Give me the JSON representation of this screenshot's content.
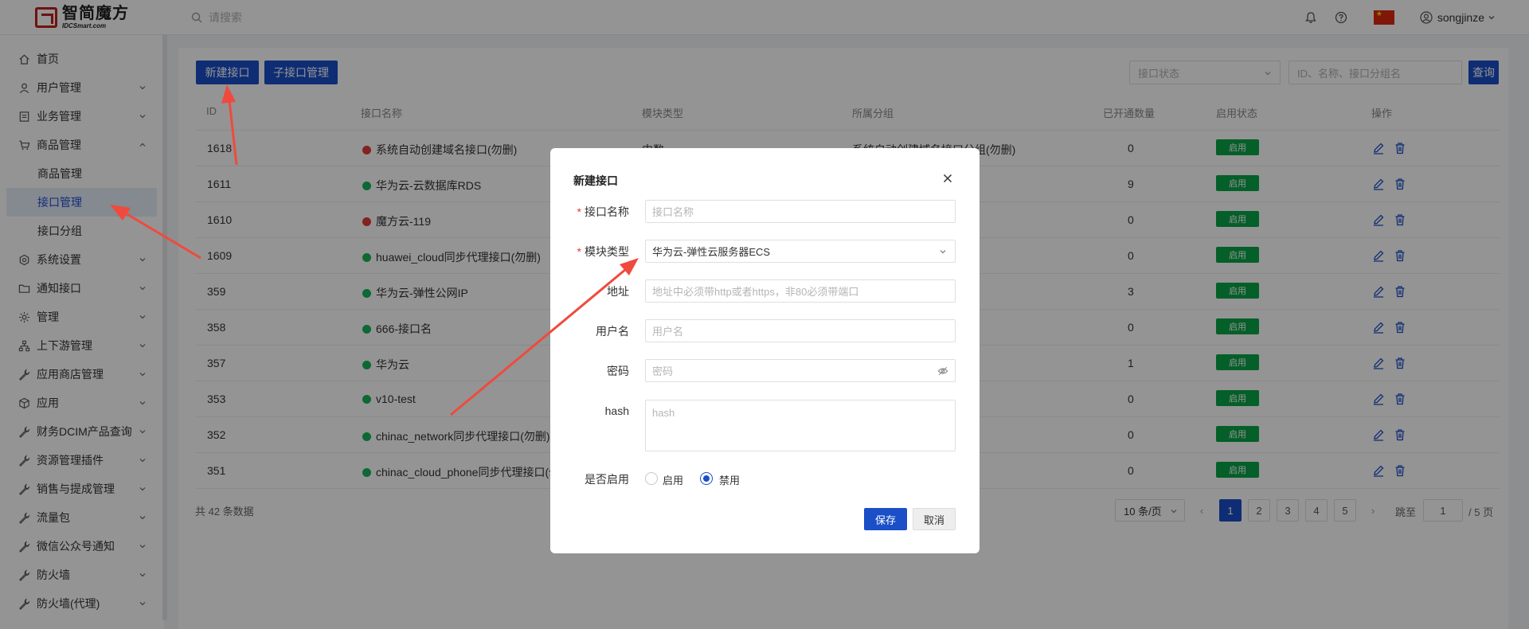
{
  "app": {
    "logo_cn": "智简魔方",
    "logo_en": "IDCSmart.com",
    "search_placeholder": "请搜索",
    "username": "songjinze",
    "colors": {
      "primary": "#1a4fc8",
      "success": "#07a447",
      "danger": "#e23b3b",
      "annotation_arrow": "#f04a3e"
    }
  },
  "sidebar": {
    "items": [
      {
        "label": "首页",
        "icon": "home-icon",
        "expandable": false
      },
      {
        "label": "用户管理",
        "icon": "user-icon",
        "expandable": true
      },
      {
        "label": "业务管理",
        "icon": "list-icon",
        "expandable": true
      },
      {
        "label": "商品管理",
        "icon": "cart-icon",
        "expandable": true,
        "expanded": true
      },
      {
        "label": "商品管理",
        "icon": "",
        "sub": true
      },
      {
        "label": "接口管理",
        "icon": "",
        "sub": true,
        "active": true
      },
      {
        "label": "接口分组",
        "icon": "",
        "sub": true
      },
      {
        "label": "系统设置",
        "icon": "gear-icon",
        "expandable": true
      },
      {
        "label": "通知接口",
        "icon": "folder-icon",
        "expandable": true
      },
      {
        "label": "管理",
        "icon": "sun-icon",
        "expandable": true
      },
      {
        "label": "上下游管理",
        "icon": "hierarchy-icon",
        "expandable": true
      },
      {
        "label": "应用商店管理",
        "icon": "wrench-icon",
        "expandable": true
      },
      {
        "label": "应用",
        "icon": "cube-icon",
        "expandable": true
      },
      {
        "label": "财务DCIM产品查询",
        "icon": "wrench-icon",
        "expandable": true
      },
      {
        "label": "资源管理插件",
        "icon": "wrench-icon",
        "expandable": true
      },
      {
        "label": "销售与提成管理",
        "icon": "wrench-icon",
        "expandable": true
      },
      {
        "label": "流量包",
        "icon": "wrench-icon",
        "expandable": true
      },
      {
        "label": "微信公众号通知",
        "icon": "wrench-icon",
        "expandable": true
      },
      {
        "label": "防火墙",
        "icon": "wrench-icon",
        "expandable": true
      },
      {
        "label": "防火墙(代理)",
        "icon": "wrench-icon",
        "expandable": true
      }
    ]
  },
  "toolbar": {
    "new_interface": "新建接口",
    "sub_interface": "子接口管理",
    "status_placeholder": "接口状态",
    "keyword_placeholder": "ID、名称、接口分组名",
    "query": "查询"
  },
  "table": {
    "headers": [
      "ID",
      "接口名称",
      "模块类型",
      "所属分组",
      "已开通数量",
      "启用状态",
      "操作"
    ],
    "rows": [
      {
        "id": "1618",
        "name": "系统自动创建域名接口(勿删)",
        "status_ok": false,
        "module": "中数",
        "group": "系统自动创建域名接口分组(勿删)",
        "count": "0",
        "state": "启用"
      },
      {
        "id": "1611",
        "name": "华为云-云数据库RDS",
        "status_ok": true,
        "module": "",
        "group": "",
        "count": "9",
        "state": "启用"
      },
      {
        "id": "1610",
        "name": "魔方云-119",
        "status_ok": false,
        "module": "",
        "group": "",
        "count": "0",
        "state": "启用"
      },
      {
        "id": "1609",
        "name": "huawei_cloud同步代理接口(勿删)",
        "status_ok": true,
        "module": "",
        "group": "",
        "count": "0",
        "state": "启用"
      },
      {
        "id": "359",
        "name": "华为云-弹性公网IP",
        "status_ok": true,
        "module": "",
        "group": "",
        "count": "3",
        "state": "启用"
      },
      {
        "id": "358",
        "name": "666-接口名",
        "status_ok": true,
        "module": "",
        "group": "",
        "count": "0",
        "state": "启用"
      },
      {
        "id": "357",
        "name": "华为云",
        "status_ok": true,
        "module": "",
        "group": "",
        "count": "1",
        "state": "启用"
      },
      {
        "id": "353",
        "name": "v10-test",
        "status_ok": true,
        "module": "",
        "group": "",
        "count": "0",
        "state": "启用"
      },
      {
        "id": "352",
        "name": "chinac_network同步代理接口(勿删)",
        "status_ok": true,
        "module": "",
        "group": "",
        "count": "0",
        "state": "启用"
      },
      {
        "id": "351",
        "name": "chinac_cloud_phone同步代理接口(勿删",
        "status_ok": true,
        "module": "",
        "group": "",
        "count": "0",
        "state": "启用"
      }
    ],
    "total": "共 42 条数据"
  },
  "pagination": {
    "page_size": "10 条/页",
    "pages": [
      "1",
      "2",
      "3",
      "4",
      "5"
    ],
    "current": "1",
    "prev": "‹",
    "next": "›",
    "jump_label": "跳至",
    "jump_value": "1",
    "total_pages": "/ 5 页"
  },
  "modal": {
    "title": "新建接口",
    "fields": {
      "name": {
        "label": "接口名称",
        "placeholder": "接口名称",
        "required": true
      },
      "module": {
        "label": "模块类型",
        "value": "华为云-弹性云服务器ECS",
        "required": true
      },
      "address": {
        "label": "地址",
        "placeholder": "地址中必须带http或者https，非80必须带端口"
      },
      "username": {
        "label": "用户名",
        "placeholder": "用户名"
      },
      "password": {
        "label": "密码",
        "placeholder": "密码"
      },
      "hash": {
        "label": "hash",
        "placeholder": "hash"
      }
    },
    "enable": {
      "label": "是否启用",
      "options": [
        "启用",
        "禁用"
      ],
      "selected": "禁用"
    },
    "save": "保存",
    "cancel": "取消"
  }
}
